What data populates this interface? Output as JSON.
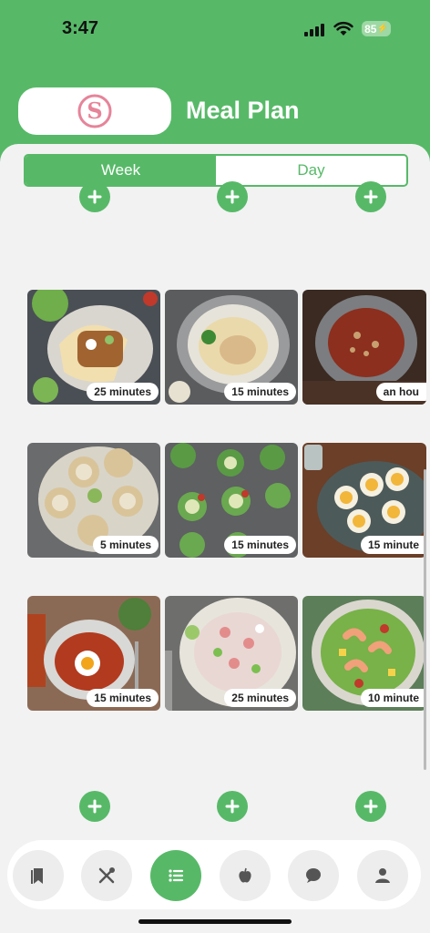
{
  "status_bar": {
    "time": "3:47",
    "battery": "85"
  },
  "header": {
    "title": "Meal Plan",
    "logo_letter": "S"
  },
  "segmented": {
    "week_label": "Week",
    "day_label": "Day",
    "selected": "Week"
  },
  "meals": [
    {
      "name": "tacos",
      "time": "25 minutes"
    },
    {
      "name": "creamy-chicken",
      "time": "15 minutes"
    },
    {
      "name": "chili-stew",
      "time": "an hou"
    },
    {
      "name": "tuna-bites",
      "time": "5 minutes"
    },
    {
      "name": "cucumber-bites",
      "time": "15 minutes"
    },
    {
      "name": "deviled-eggs",
      "time": "15 minute"
    },
    {
      "name": "shakshuka",
      "time": "15 minutes"
    },
    {
      "name": "ceviche",
      "time": "25 minutes"
    },
    {
      "name": "shrimp-salad",
      "time": "10 minute"
    }
  ],
  "tabs": [
    {
      "name": "bookmark-icon"
    },
    {
      "name": "utensils-icon"
    },
    {
      "name": "list-icon",
      "active": true
    },
    {
      "name": "apple-icon"
    },
    {
      "name": "chat-icon"
    },
    {
      "name": "person-icon"
    }
  ],
  "colors": {
    "accent": "#57b968",
    "logo_pink": "#e6849a"
  }
}
